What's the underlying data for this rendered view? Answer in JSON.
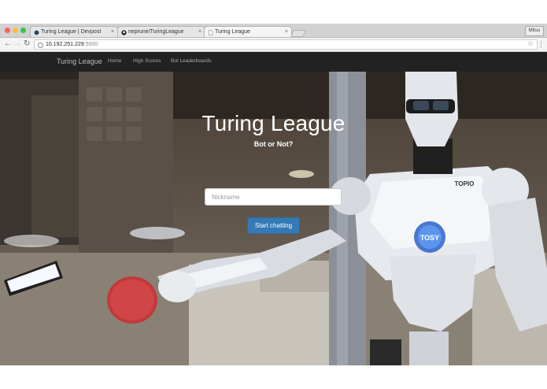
{
  "browser": {
    "tabs": [
      {
        "label": "Turing League | Devpost",
        "active": false
      },
      {
        "label": "neprune/TuringLeague",
        "active": false
      },
      {
        "label": "Turing League",
        "active": true
      }
    ],
    "profile_label": "Mitsu",
    "url_host": "10.192.251.229",
    "url_port": ":5000",
    "close_glyph": "×",
    "back_glyph": "←",
    "forward_glyph": "→",
    "reload_glyph": "↻",
    "star_glyph": "☆",
    "menu_glyph": "⋮"
  },
  "nav": {
    "brand": "Turing League",
    "links": [
      "Home",
      "High Scores",
      "Bot Leaderboards"
    ]
  },
  "hero": {
    "title": "Turing League",
    "subtitle": "Bot or Not?",
    "nickname_placeholder": "Nickname",
    "button_label": "Start chatting"
  },
  "robot": {
    "chest_text": "TOPIO",
    "emblem_text": "TOSY"
  },
  "colors": {
    "navbar": "#222222",
    "button": "#337ab7"
  }
}
